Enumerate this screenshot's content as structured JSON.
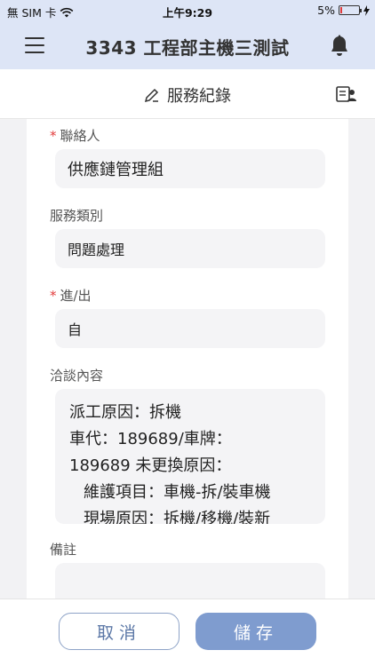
{
  "status_bar": {
    "carrier": "無 SIM 卡",
    "time": "上午9:29",
    "battery_percent": "5%"
  },
  "header": {
    "title": "3343 工程部主機三測試"
  },
  "subheader": {
    "title": "服務紀錄"
  },
  "form": {
    "contact": {
      "label": "聯絡人",
      "required_mark": "*",
      "value": "供應鏈管理組"
    },
    "service_type": {
      "label": "服務類別",
      "value": "問題處理"
    },
    "in_out": {
      "label": "進/出",
      "required_mark": "*",
      "value": "自"
    },
    "discussion": {
      "label": "洽談內容",
      "lines": [
        "派工原因：拆機",
        "車代：189689/車牌：",
        "189689 未更換原因：",
        "維護項目：車機-拆/裝車機",
        "現場原因：拆機/移機/裝新"
      ]
    },
    "remarks": {
      "label": "備註",
      "value": ""
    }
  },
  "footer": {
    "cancel_label": "取消",
    "save_label": "儲存"
  },
  "colors": {
    "header_bg": "#dde5f6",
    "primary": "#7f9ccf",
    "required": "#e23b3b"
  }
}
